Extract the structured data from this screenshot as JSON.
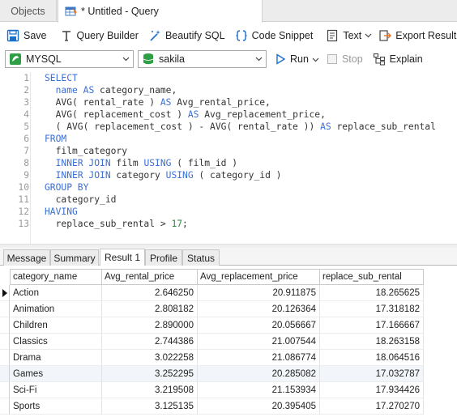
{
  "tabs": {
    "objects": "Objects",
    "query": "* Untitled - Query"
  },
  "toolbar": {
    "save": "Save",
    "query_builder": "Query Builder",
    "beautify": "Beautify SQL",
    "code_snippet": "Code Snippet",
    "text": "Text",
    "export_result": "Export Result"
  },
  "connection": {
    "connection_value": "MYSQL",
    "database_value": "sakila",
    "run": "Run",
    "stop": "Stop",
    "explain": "Explain"
  },
  "editor": {
    "line_numbers": [
      "1",
      "2",
      "3",
      "4",
      "5",
      "6",
      "7",
      "8",
      "9",
      "10",
      "11",
      "12",
      "13"
    ]
  },
  "result_tabs": [
    "Message",
    "Summary",
    "Result 1",
    "Profile",
    "Status"
  ],
  "result_tabs_active": "Result 1",
  "grid": {
    "columns": [
      "category_name",
      "Avg_rental_price",
      "Avg_replacement_price",
      "replace_sub_rental"
    ],
    "rows": [
      [
        "Action",
        "2.646250",
        "20.911875",
        "18.265625"
      ],
      [
        "Animation",
        "2.808182",
        "20.126364",
        "17.318182"
      ],
      [
        "Children",
        "2.890000",
        "20.056667",
        "17.166667"
      ],
      [
        "Classics",
        "2.744386",
        "21.007544",
        "18.263158"
      ],
      [
        "Drama",
        "3.022258",
        "21.086774",
        "18.064516"
      ],
      [
        "Games",
        "3.252295",
        "20.285082",
        "17.032787"
      ],
      [
        "Sci-Fi",
        "3.219508",
        "21.153934",
        "17.934426"
      ],
      [
        "Sports",
        "3.125135",
        "20.395405",
        "17.270270"
      ]
    ]
  },
  "colors": {
    "keyword": "#3b6fd6",
    "number": "#2a8a3e",
    "accent": "#1a6fc9"
  }
}
